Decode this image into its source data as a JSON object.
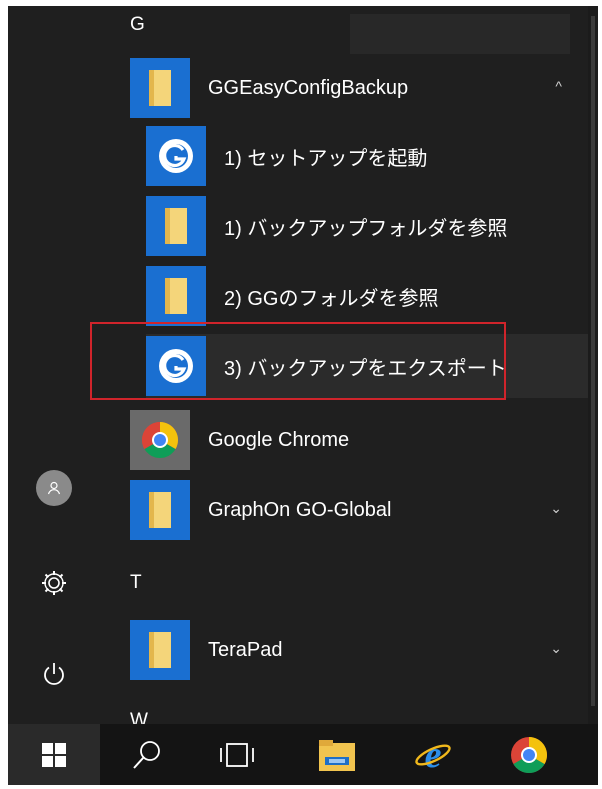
{
  "section_letters": {
    "g": "G",
    "t": "T",
    "w": "W"
  },
  "group": {
    "label": "GGEasyConfigBackup",
    "expanded": true,
    "chevron": "^"
  },
  "subitems": [
    {
      "label": "1) セットアップを起動",
      "icon": "gg-logo-icon"
    },
    {
      "label": "1) バックアップフォルダを参照",
      "icon": "folder-icon"
    },
    {
      "label": "2) GGのフォルダを参照",
      "icon": "folder-icon"
    },
    {
      "label": "3) バックアップをエクスポート",
      "icon": "gg-logo-icon"
    }
  ],
  "apps": {
    "chrome": {
      "label": "Google Chrome",
      "icon": "chrome-icon"
    },
    "graphon": {
      "label": "GraphOn GO-Global",
      "icon": "folder-icon",
      "chevron": "⌄"
    },
    "terapad": {
      "label": "TeraPad",
      "icon": "folder-icon",
      "chevron": "⌄"
    }
  },
  "rail": [
    "user-icon",
    "settings-icon",
    "power-icon"
  ],
  "taskbar": [
    "windows-start-icon",
    "search-icon",
    "task-view-icon",
    "file-explorer-icon",
    "internet-explorer-icon",
    "chrome-icon"
  ],
  "colors": {
    "accent": "#1a6fd1",
    "highlight_border": "#d0242b",
    "background": "#1f1f1f"
  }
}
